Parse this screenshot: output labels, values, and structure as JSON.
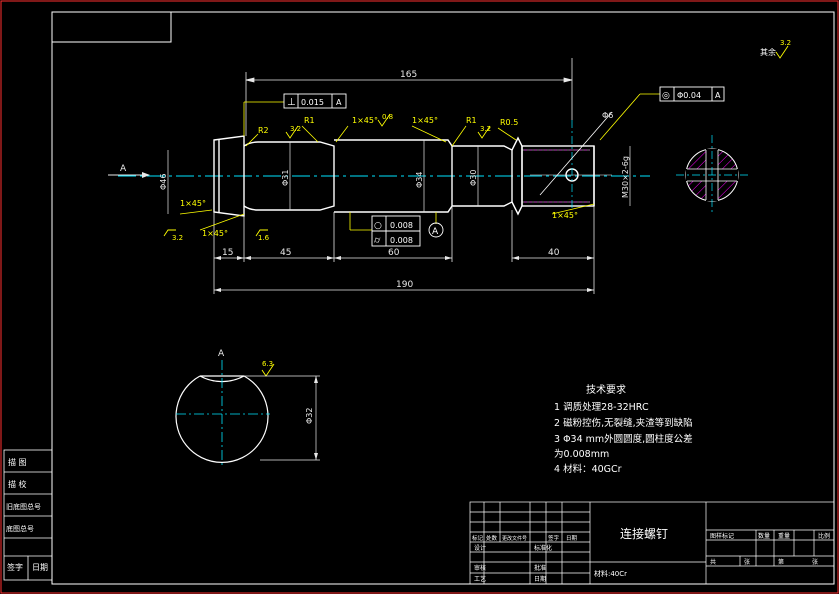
{
  "colors": {
    "background": "#000000",
    "frame": "#ff3030",
    "outline": "#ffffff",
    "dimension": "#e8e8e8",
    "annotation": "#ffff00",
    "centerline": "#00e5ff",
    "hatch": "#ff00ff"
  },
  "dims": {
    "d165": "165",
    "d15": "15",
    "d45": "45",
    "d60": "60",
    "d40": "40",
    "d190": "190",
    "d6": "Φ6",
    "dia_a": "Φ31",
    "dia_b": "Φ34",
    "dia_c": "Φ30",
    "dia_d": "Φ31",
    "thread": "M30×2-6g",
    "dia_left": "Φ46",
    "section_dim": "Φ32"
  },
  "annotations": {
    "view_arrow": "A",
    "section_label": "A",
    "r2": "R2",
    "r1_a": "R1",
    "r1_b": "R1",
    "r05": "R0.5",
    "ch1": "1×45°",
    "ch2": "1×45°",
    "ch3": "1×45°",
    "ch4": "1×45°",
    "ch5": "1×45°",
    "rough_32a": "3.2",
    "rough_08": "0.8",
    "rough_32b": "3.2",
    "rough_32c": "3.2",
    "rough_16": "1.6",
    "rough_63": "6.3",
    "rough_other": "其余",
    "rough_other_val": "3.2",
    "datum": "A"
  },
  "tolerances": {
    "perp": {
      "symbol": "⊥",
      "value": "0.015",
      "datum": "A"
    },
    "position": {
      "symbol": "◎",
      "value": "Φ0.04",
      "datum": "A"
    },
    "roundness": {
      "symbol": "○",
      "value": "0.008"
    },
    "cylindricity": {
      "symbol": "⌭",
      "value": "0.008"
    }
  },
  "requirements": {
    "title": "技术要求",
    "lines": [
      "1 调质处理28-32HRC",
      "2 磁粉控伤,无裂缝,夹渣等到缺陷",
      "3 Φ34    mm外圆圆度,圆柱度公差",
      "  为0.008mm",
      "4 材料：40GCr"
    ]
  },
  "title_block": {
    "part_name": "连接螺钉",
    "material_label": "材料:40Cr",
    "row_labels": [
      "标记",
      "处数",
      "更改文件号",
      "签字",
      "日期"
    ],
    "roles": [
      "设计",
      "审核",
      "工艺"
    ],
    "standardize": "标准化",
    "approve": "批准",
    "date": "日期",
    "right_headers": [
      "图样标记",
      "数量",
      "重量",
      "比例"
    ],
    "sheet": [
      "共",
      "张",
      "第",
      "张"
    ]
  },
  "side_block": {
    "labels": [
      "描 图",
      "描 校",
      "旧底图总号",
      "底图总号",
      "签字",
      "日期"
    ]
  }
}
